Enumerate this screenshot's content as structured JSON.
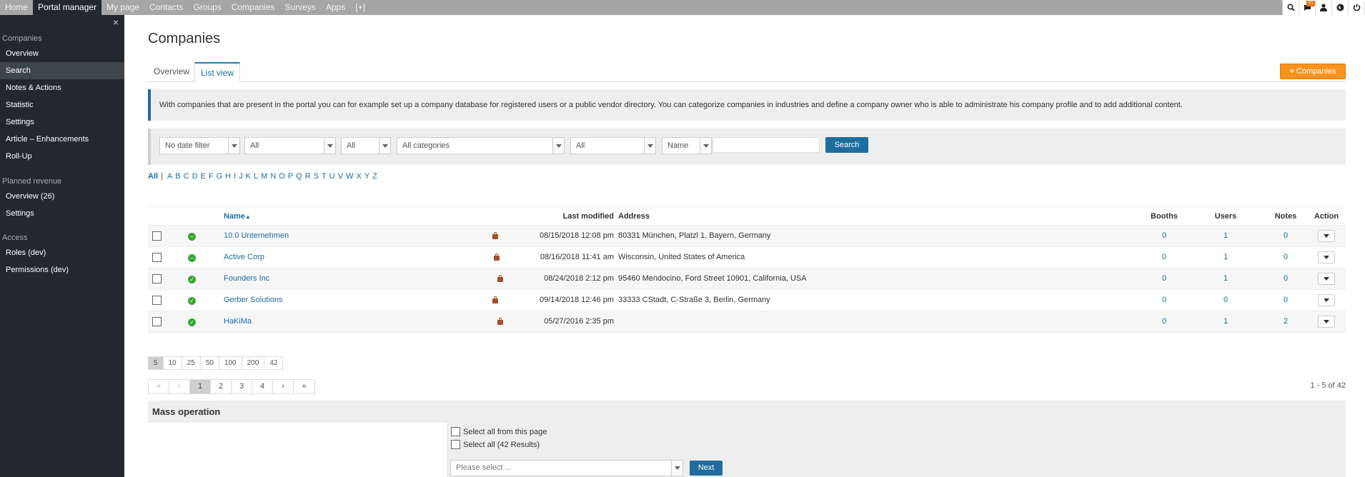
{
  "topnav": {
    "items": [
      "Home",
      "Portal manager",
      "My page",
      "Contacts",
      "Groups",
      "Companies",
      "Surveys",
      "Apps",
      "[+]"
    ],
    "active_index": 1,
    "notification_count": "31",
    "icons": [
      "zoom-icon",
      "chat-icon",
      "user-icon",
      "globe-icon",
      "power-icon"
    ]
  },
  "sidebar": {
    "close_glyph": "×",
    "sections": [
      {
        "title": "Companies",
        "items": [
          "Overview",
          "Search",
          "Notes & Actions",
          "Statistic",
          "Settings",
          "Article – Enhancements",
          "Roll-Up"
        ]
      },
      {
        "title": "Planned revenue",
        "items": [
          "Overview (26)",
          "Settings"
        ]
      },
      {
        "title": "Access",
        "items": [
          "Roles (dev)",
          "Permissions (dev)"
        ]
      }
    ],
    "active_item": "Search"
  },
  "main": {
    "title": "Companies",
    "tabs": [
      "Overview",
      "List view"
    ],
    "active_tab": "List view",
    "add_button": "Companies",
    "info_text": "With companies that are present in the portal you can for example set up a company database for registered users or a public vendor directory. You can categorize companies in industries and define a company owner who is able to administrate his company profile and to add additional content."
  },
  "filters": {
    "date": "No date filter",
    "filter2": "All",
    "filter3": "All",
    "category": "All categories",
    "filter5": "All",
    "field": "Name",
    "search_value": "",
    "search_button": "Search"
  },
  "alphabet": {
    "all": "All",
    "separator": "|",
    "letters": [
      "A",
      "B",
      "C",
      "D",
      "E",
      "F",
      "G",
      "H",
      "I",
      "J",
      "K",
      "L",
      "M",
      "N",
      "O",
      "P",
      "Q",
      "R",
      "S",
      "T",
      "U",
      "V",
      "W",
      "X",
      "Y",
      "Z"
    ]
  },
  "table": {
    "headers": {
      "name": "Name",
      "last_modified": "Last modified",
      "address": "Address",
      "booths": "Booths",
      "users": "Users",
      "notes": "Notes",
      "action": "Action"
    },
    "rows": [
      {
        "name": "10.0 Unternehmen",
        "status": "minus",
        "modified": "08/15/2018 12:08 pm",
        "address": "80331 München, Platzl 1, Bayern, Germany",
        "booths": "0",
        "users": "1",
        "notes": "0"
      },
      {
        "name": "Active Corp",
        "status": "minus",
        "modified": "08/16/2018 11:41 am",
        "address": "Wisconsin, United States of America",
        "booths": "0",
        "users": "1",
        "notes": "0"
      },
      {
        "name": "Founders Inc",
        "status": "check",
        "modified": "08/24/2018 2:12 pm",
        "address": "95460 Mendocino, Ford Street 10901, California, USA",
        "booths": "0",
        "users": "1",
        "notes": "0"
      },
      {
        "name": "Gerber Solutions",
        "status": "check",
        "modified": "09/14/2018 12:46 pm",
        "address": "33333 CStadt, C-Straße 3, Berlin, Germany",
        "booths": "0",
        "users": "0",
        "notes": "0"
      },
      {
        "name": "HaKiMa",
        "status": "check",
        "modified": "05/27/2016 2:35 pm",
        "address": "",
        "booths": "0",
        "users": "1",
        "notes": "2"
      }
    ]
  },
  "page_sizes": {
    "options": [
      "5",
      "10",
      "25",
      "50",
      "100",
      "200",
      "42"
    ],
    "active": "5"
  },
  "pager": {
    "first": "«",
    "prev": "‹",
    "pages": [
      "1",
      "2",
      "3",
      "4"
    ],
    "active": "1",
    "next": "›",
    "last": "»",
    "summary": "1 - 5 of 42"
  },
  "mass": {
    "title": "Mass operation",
    "select_page": "Select all from this page",
    "select_all": "Select all (42 Results)",
    "placeholder": "Please select ...",
    "next": "Next"
  },
  "colors": {
    "accent": "#1f6d9e",
    "orange": "#f7931e",
    "sidebar": "#22282e",
    "status_green": "#3aa535"
  }
}
